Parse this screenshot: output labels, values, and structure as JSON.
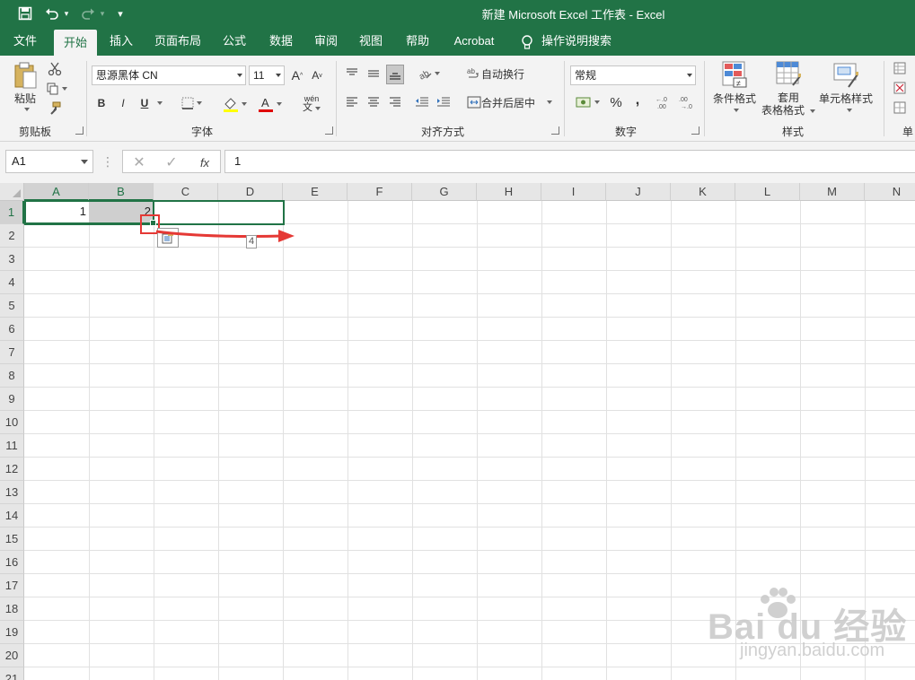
{
  "window": {
    "title": "新建 Microsoft Excel 工作表  -  Excel"
  },
  "quick_access": {
    "save_icon": "save-icon",
    "undo_icon": "undo-icon",
    "redo_icon": "redo-icon",
    "customize": "▾"
  },
  "tabs": [
    "文件",
    "开始",
    "插入",
    "页面布局",
    "公式",
    "数据",
    "审阅",
    "视图",
    "帮助",
    "Acrobat",
    "操作说明搜索"
  ],
  "active_tab": "开始",
  "ribbon": {
    "clipboard": {
      "label": "剪贴板",
      "paste": "粘贴"
    },
    "font": {
      "label": "字体",
      "font_name": "思源黑体 CN",
      "font_size": "11",
      "bold": "B",
      "italic": "I",
      "underline": "U"
    },
    "alignment": {
      "label": "对齐方式",
      "wrap_text": "自动换行",
      "merge_center": "合并后居中"
    },
    "number": {
      "label": "数字",
      "format": "常规",
      "percent": "%",
      "comma": ","
    },
    "styles": {
      "label": "样式",
      "conditional": "条件格式",
      "table_format_1": "套用",
      "table_format_2": "表格格式",
      "cell_styles": "单元格样式"
    },
    "cells": {
      "label": "单"
    }
  },
  "formula_bar": {
    "name_box": "A1",
    "fx": "fx",
    "value": "1"
  },
  "columns": [
    "A",
    "B",
    "C",
    "D",
    "E",
    "F",
    "G",
    "H",
    "I",
    "J",
    "K",
    "L",
    "M",
    "N"
  ],
  "rows": [
    "1",
    "2",
    "3",
    "4",
    "5",
    "6",
    "7",
    "8",
    "9",
    "10",
    "11",
    "12",
    "13",
    "14",
    "15",
    "16",
    "17",
    "18",
    "19",
    "20",
    "21"
  ],
  "cells": {
    "A1": "1",
    "B1": "2"
  },
  "fill_tooltip": "4",
  "watermark": {
    "brand": "Bai du 经验",
    "url": "jingyan.baidu.com"
  },
  "colors": {
    "excel_green": "#217346",
    "highlight_red": "#e53935"
  }
}
